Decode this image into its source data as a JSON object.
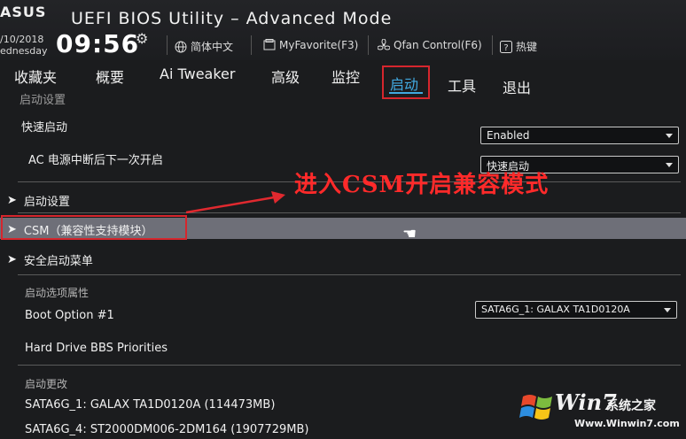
{
  "header": {
    "logo": "ASUS",
    "title": "UEFI BIOS Utility – Advanced Mode",
    "date": "/10/2018",
    "weekday": "ednesday",
    "time": "09:56",
    "language": "简体中文",
    "myfavorite": "MyFavorite(F3)",
    "qfan": "Qfan Control(F6)",
    "hotkeys": "热键"
  },
  "nav": {
    "items": [
      "收藏夹",
      "概要",
      "Ai Tweaker",
      "高级",
      "监控",
      "启动",
      "工具",
      "退出"
    ],
    "active_index": 5
  },
  "breadcrumb": "启动设置",
  "settings": {
    "fast_boot_label": "快速启动",
    "fast_boot_value": "Enabled",
    "ac_power_label": "AC 电源中断后下一次开启",
    "ac_power_value": "快速启动",
    "boot_config": "启动设置",
    "csm": "CSM（兼容性支持模块）",
    "secure_boot": "安全启动菜单",
    "boot_option_priorities": "启动选项属性",
    "boot_option1_label": "Boot Option #1",
    "boot_option1_value": "SATA6G_1: GALAX TA1D0120A",
    "hdd_bbs": "Hard Drive BBS Priorities",
    "boot_override": "启动更改",
    "override_items": [
      "SATA6G_1: GALAX TA1D0120A  (114473MB)",
      "SATA6G_4: ST2000DM006-2DM164  (1907729MB)"
    ]
  },
  "annotation": "进入CSM开启兼容模式",
  "watermark": {
    "brand": "Win7",
    "brand_cn": "系统之家",
    "url": "Www.Winwin7.com"
  },
  "colors": {
    "accent": "#41a9e0",
    "highlight": "#d6262d",
    "annotation": "#ff2a2a"
  }
}
